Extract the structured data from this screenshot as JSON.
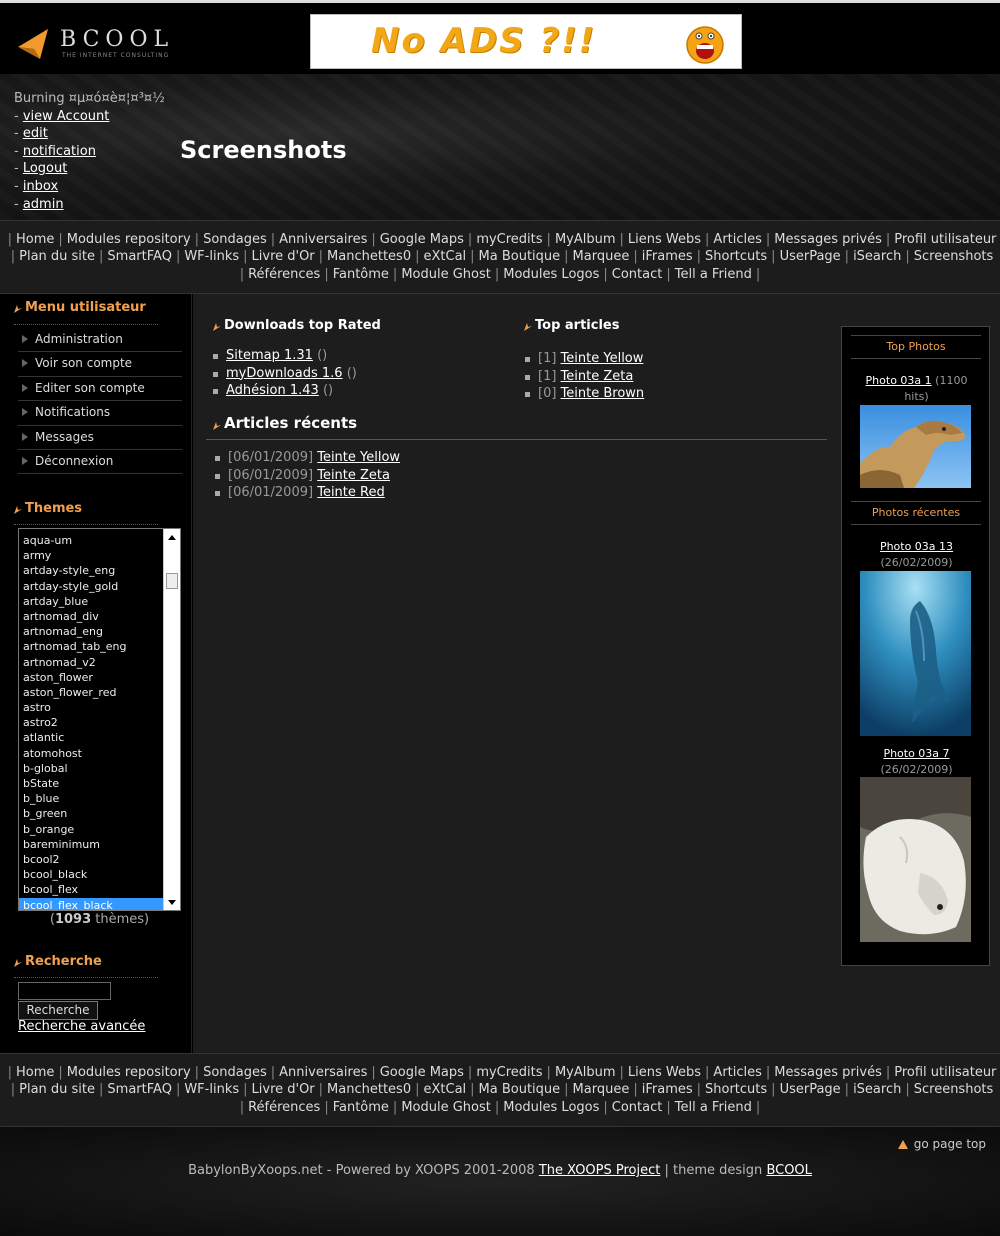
{
  "banner": {
    "text": "No ADS ?!!"
  },
  "logo": {
    "name": "BCOOL",
    "tagline": "THE INTERNET CONSULTING"
  },
  "user_menu": {
    "username": "Burning ¤µ¤ó¤è¤¦¤³¤½",
    "links": [
      "view Account",
      "edit",
      "notification",
      "Logout",
      "inbox",
      "admin"
    ]
  },
  "page_title": "Screenshots",
  "nav": {
    "line1": [
      "Home",
      "Modules repository",
      "Sondages",
      "Anniversaires",
      "Google Maps",
      "myCredits",
      "MyAlbum",
      "Liens Webs",
      "Articles",
      "Messages privés",
      "Profil utilisateur"
    ],
    "line2": [
      "Plan du site",
      "SmartFAQ",
      "WF-links",
      "Livre d'Or",
      "Manchettes0",
      "eXtCal",
      "Ma Boutique",
      "Marquee",
      "iFrames",
      "Shortcuts",
      "UserPage",
      "iSearch",
      "Screenshots"
    ],
    "line3": [
      "Références",
      "Fantôme",
      "Module Ghost",
      "Modules Logos",
      "Contact",
      "Tell a Friend"
    ]
  },
  "left": {
    "menu_title": "Menu utilisateur",
    "menu_items": [
      "Administration",
      "Voir son compte",
      "Editer son compte",
      "Notifications",
      "Messages",
      "Déconnexion"
    ],
    "themes_title": "Themes",
    "themes": [
      "aqua-um",
      "army",
      "artday-style_eng",
      "artday-style_gold",
      "artday_blue",
      "artnomad_div",
      "artnomad_eng",
      "artnomad_tab_eng",
      "artnomad_v2",
      "aston_flower",
      "aston_flower_red",
      "astro",
      "astro2",
      "atlantic",
      "atomohost",
      "b-global",
      "bState",
      "b_blue",
      "b_green",
      "b_orange",
      "bareminimum",
      "bcool2",
      "bcool_black",
      "bcool_flex",
      "bcool_flex_black"
    ],
    "selected_theme": "bcool_flex_black",
    "theme_count_num": "1093",
    "theme_count_label": "thèmes",
    "search_title": "Recherche",
    "search_button": "Recherche",
    "advanced_search": "Recherche avancée"
  },
  "downloads": {
    "title": "Downloads top Rated",
    "items": [
      {
        "name": "Sitemap 1.31",
        "suffix": "()"
      },
      {
        "name": "myDownloads 1.6",
        "suffix": "()"
      },
      {
        "name": "Adhésion 1.43",
        "suffix": "()"
      }
    ]
  },
  "top_articles": {
    "title": "Top articles",
    "items": [
      {
        "prefix": "[1]",
        "name": "Teinte Yellow"
      },
      {
        "prefix": "[1]",
        "name": "Teinte Zeta"
      },
      {
        "prefix": "[0]",
        "name": "Teinte Brown"
      }
    ]
  },
  "recent_articles": {
    "title": "Articles récents",
    "items": [
      {
        "prefix": "[06/01/2009]",
        "name": "Teinte Yellow"
      },
      {
        "prefix": "[06/01/2009]",
        "name": "Teinte Zeta"
      },
      {
        "prefix": "[06/01/2009]",
        "name": "Teinte Red"
      }
    ]
  },
  "photos": {
    "top_title": "Top Photos",
    "top": {
      "name": "Photo 03a 1",
      "info_line1": "(1100",
      "info_line2": "hits)"
    },
    "recent_title": "Photos récentes",
    "recent": [
      {
        "name": "Photo 03a 13",
        "date": "(26/02/2009)"
      },
      {
        "name": "Photo 03a 7",
        "date": "(26/02/2009)"
      }
    ]
  },
  "footer": {
    "go_top": "go page top",
    "credits_prefix": "BabylonByXoops.net - Powered by XOOPS 2001-2008",
    "xoops_link": "The XOOPS Project",
    "credits_mid": "| theme design",
    "bcool_link": "BCOOL"
  },
  "colors": {
    "accent": "#f0a050",
    "selection": "#3399ff",
    "banner_text": "#f2a716"
  }
}
